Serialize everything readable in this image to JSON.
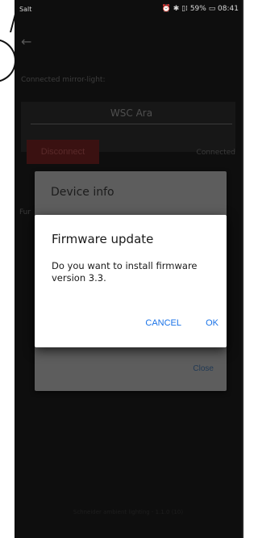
{
  "status_bar": {
    "carrier": "Salt",
    "right_status": "⏰ ✱ ▯⁞ 59% ▭ 08:41"
  },
  "app": {
    "back_icon": "arrow-left-icon",
    "connected_label": "Connected mirror-light:",
    "device_name": "WSC Ara",
    "disconnect_label": "Disconnect",
    "connection_status": "Connected",
    "partial_label": "Fur",
    "footer": "Schneider ambient lighting - 1.1.0 (10)"
  },
  "device_info_dialog": {
    "title": "Device info",
    "close_label": "Close"
  },
  "firmware_dialog": {
    "title": "Firmware update",
    "message": "Do you want to install firmware version 3.3.",
    "cancel_label": "CANCEL",
    "ok_label": "OK",
    "accent_color": "#1a73e8"
  }
}
